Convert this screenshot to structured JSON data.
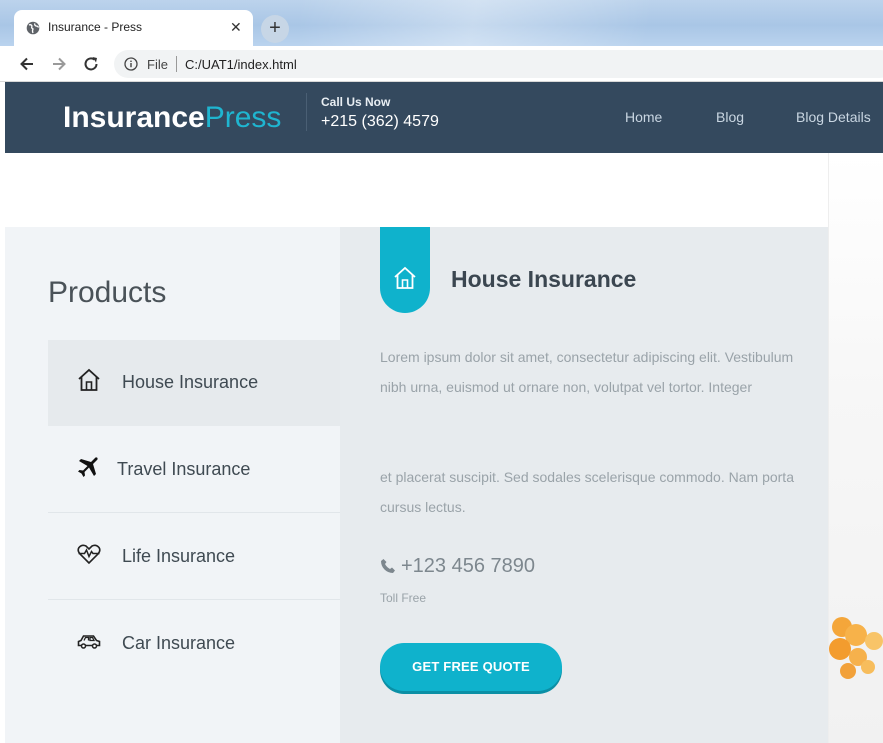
{
  "browser": {
    "tab_title": "Insurance - Press",
    "new_tab_symbol": "+",
    "close_symbol": "✕",
    "address_scheme_label": "File",
    "address_url": "C:/UAT1/index.html"
  },
  "header": {
    "logo_part1": "Insurance",
    "logo_part2": "Press",
    "call_label": "Call Us Now",
    "call_phone": "+215 (362) 4579",
    "menu": [
      "Home",
      "Blog",
      "Blog Details"
    ]
  },
  "sidebar": {
    "title": "Products",
    "items": [
      {
        "label": "House Insurance",
        "icon": "house-icon",
        "active": true
      },
      {
        "label": "Travel Insurance",
        "icon": "airplane-icon",
        "active": false
      },
      {
        "label": "Life Insurance",
        "icon": "heartbeat-icon",
        "active": false
      },
      {
        "label": "Car Insurance",
        "icon": "car-icon",
        "active": false
      }
    ]
  },
  "content": {
    "icon": "house-icon",
    "title": "House Insurance",
    "paragraph1": "Lorem ipsum dolor sit amet, consectetur adipiscing elit. Vestibulum nibh urna, euismod ut ornare non, volutpat vel tortor. Integer",
    "paragraph2": "et placerat suscipit. Sed sodales scelerisque commodo. Nam porta cursus lectus.",
    "phone": "+123 456 7890",
    "phone_note": "Toll Free",
    "button_label": "GET FREE QUOTE"
  },
  "colors": {
    "accent": "#0fb2cc",
    "header_bg": "#34495e",
    "sidebar_bg": "#f1f4f7",
    "content_bg": "#e7ebee"
  }
}
